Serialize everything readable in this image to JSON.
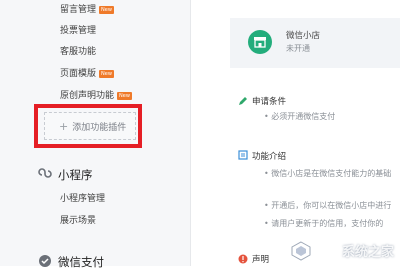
{
  "sidebar": {
    "items_top": [
      {
        "label": "留言管理",
        "badge": "New"
      },
      {
        "label": "投票管理",
        "badge": ""
      },
      {
        "label": "客服功能",
        "badge": ""
      },
      {
        "label": "页面模版",
        "badge": "New"
      },
      {
        "label": "原创声明功能",
        "badge": "New"
      }
    ],
    "add_plugin_label": "添加功能插件",
    "miniprogram": {
      "title": "小程序",
      "items": [
        "小程序管理",
        "展示场景"
      ]
    },
    "wechat_pay": {
      "title": "微信支付"
    }
  },
  "main": {
    "shop_card": {
      "title": "微信小店",
      "status": "未开通"
    },
    "apply_conditions": {
      "title": "申请条件",
      "bullet": "• 必须开通微信支付"
    },
    "feature_intro": {
      "title": "功能介绍",
      "bullets": [
        "• 微信小店是在微信支付能力的基础",
        "• 开通后，你可以在微信小店中进行",
        "• 请用户更新于的信用，支付你的"
      ]
    },
    "statement": {
      "title": "声明"
    }
  },
  "watermark": {
    "text": "系统之家"
  },
  "colors": {
    "highlight": "#e51e25",
    "brand_green": "#23ad7c",
    "new_badge": "#ef7a2a"
  }
}
